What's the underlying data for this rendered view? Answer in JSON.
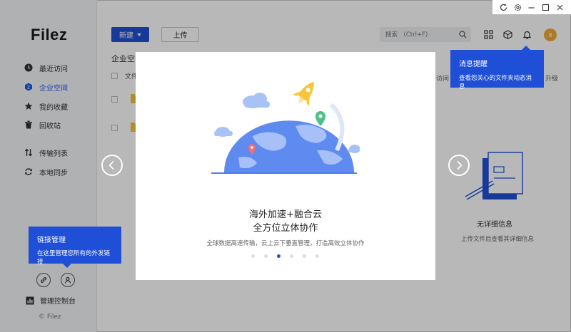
{
  "app": {
    "logo": "Filez",
    "copyright": "© Filez"
  },
  "sidebar": {
    "items": [
      {
        "label": "最近访问",
        "icon": "clock-icon"
      },
      {
        "label": "企业空间",
        "icon": "enterprise-space-icon",
        "active": true
      },
      {
        "label": "我的收藏",
        "icon": "star-icon"
      },
      {
        "label": "回收站",
        "icon": "trash-icon"
      },
      {
        "label": "传输列表",
        "icon": "transfer-icon"
      },
      {
        "label": "本地同步",
        "icon": "sync-icon"
      }
    ],
    "admin_console": "管理控制台"
  },
  "toolbar": {
    "new_label": "新建",
    "upload_label": "上传",
    "search_placeholder": "搜索　(Ctrl+F)",
    "avatar_text": "8"
  },
  "main": {
    "breadcrumb": "企业空间",
    "list_header": "文件",
    "col_visitor": "访问",
    "col_upgrade": "升级"
  },
  "detail": {
    "empty_title": "无详细信息",
    "empty_sub": "上传文件后查看其详细信息"
  },
  "tooltips": {
    "link_title": "链接管理",
    "link_desc": "在这里管理您所有的外发链接",
    "notice_title": "消息提醒",
    "notice_desc": "查看您关心的文件夹动态消息"
  },
  "modal": {
    "title_line1": "海外加速+融合云",
    "title_line2": "全方位立体协作",
    "desc": "全球数据高速传输，云上云下垂直管理，打造高效立体协作",
    "page_count": 6,
    "active_page": 3
  },
  "colors": {
    "accent": "#1f4fd6",
    "folder": "#f7c441",
    "avatar": "#f2a93b"
  }
}
